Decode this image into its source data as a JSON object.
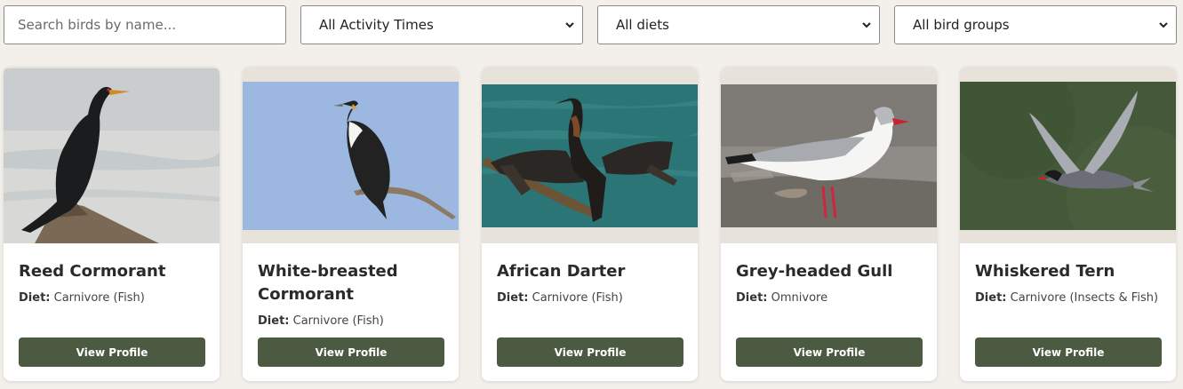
{
  "search": {
    "placeholder": "Search birds by name..."
  },
  "filters": {
    "activity": {
      "selected": "All Activity Times"
    },
    "diet": {
      "selected": "All diets"
    },
    "group": {
      "selected": "All bird groups"
    }
  },
  "birds": [
    {
      "name": "Reed Cormorant",
      "diet_label": "Diet:",
      "diet": "Carnivore (Fish)",
      "button": "View Profile"
    },
    {
      "name": "White-breasted Cormorant",
      "diet_label": "Diet:",
      "diet": "Carnivore (Fish)",
      "button": "View Profile"
    },
    {
      "name": "African Darter",
      "diet_label": "Diet:",
      "diet": "Carnivore (Fish)",
      "button": "View Profile"
    },
    {
      "name": "Grey-headed Gull",
      "diet_label": "Diet:",
      "diet": "Omnivore",
      "button": "View Profile"
    },
    {
      "name": "Whiskered Tern",
      "diet_label": "Diet:",
      "diet": "Carnivore (Insects & Fish)",
      "button": "View Profile"
    }
  ],
  "colors": {
    "page_bg": "#f3f0eb",
    "button_bg": "#4b5a40",
    "image_frame": "#e8e3da"
  }
}
